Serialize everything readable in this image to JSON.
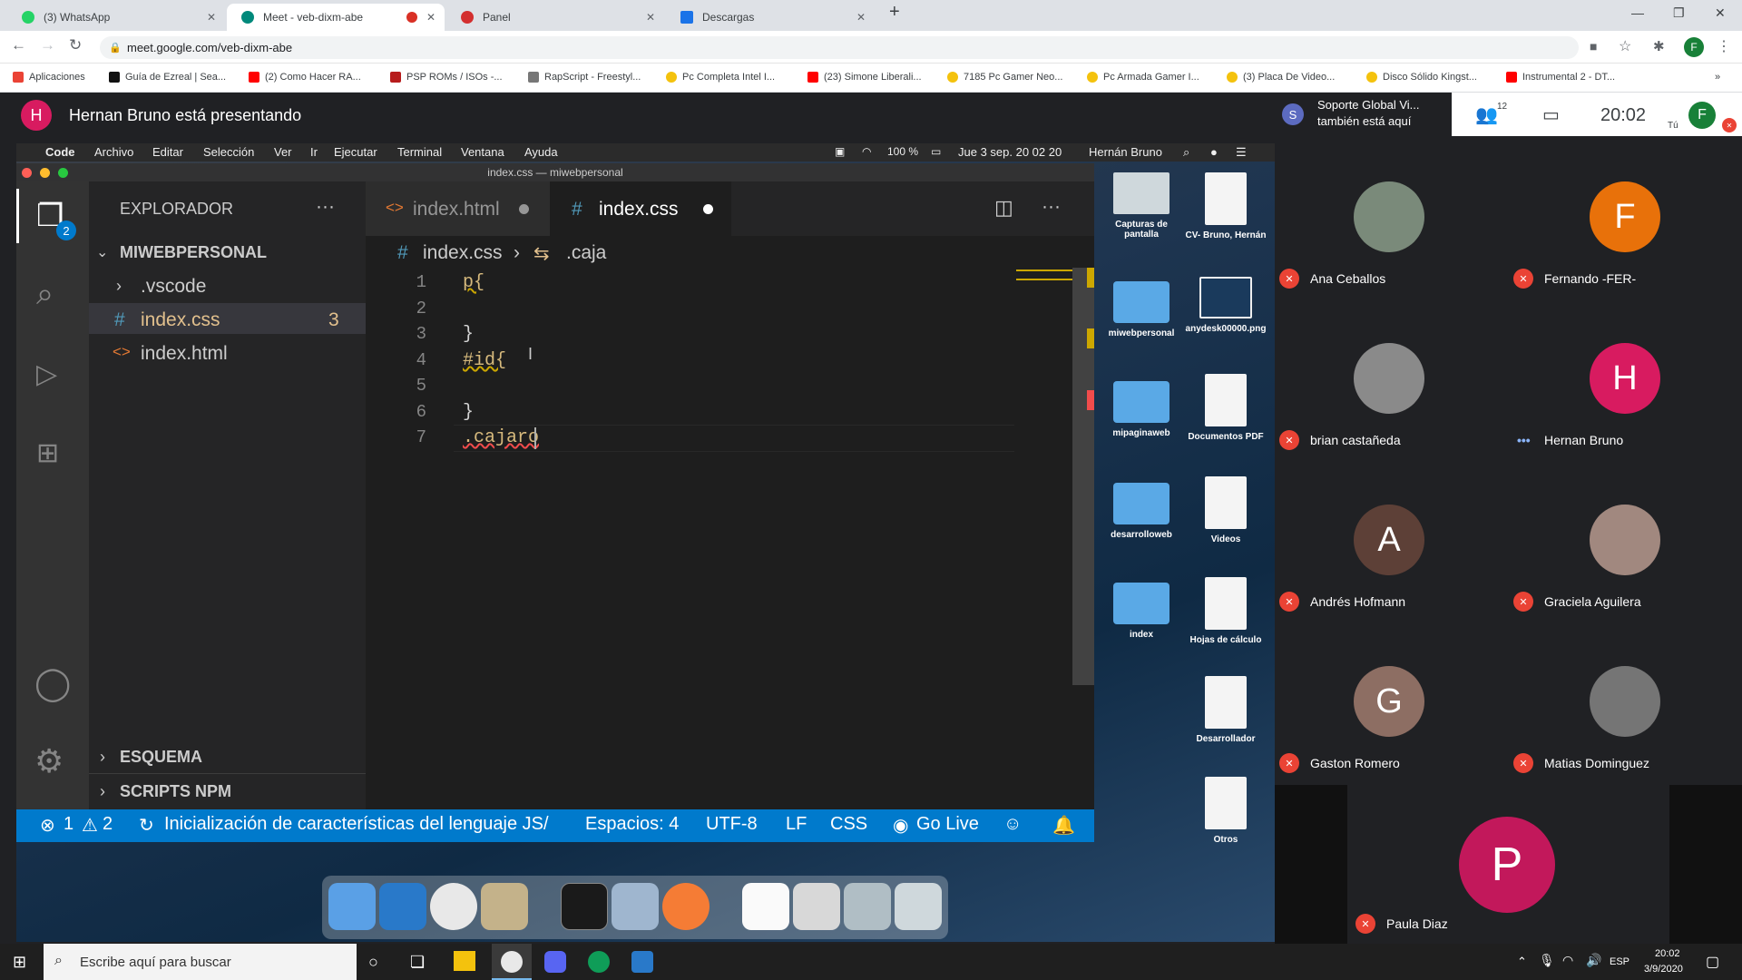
{
  "browser": {
    "tabs": [
      {
        "title": "(3) WhatsApp",
        "color": "#25d366"
      },
      {
        "title": "Meet - veb-dixm-abe",
        "color": "#00897b"
      },
      {
        "title": "Panel",
        "color": "#d32f2f"
      },
      {
        "title": "Descargas",
        "color": "#1a73e8"
      }
    ],
    "url": "meet.google.com/veb-dixm-abe",
    "bookmarks": [
      {
        "label": "Aplicaciones",
        "color": "#ea4335"
      },
      {
        "label": "Guía de Ezreal | Sea...",
        "color": "#111111"
      },
      {
        "label": "(2) Como Hacer RA...",
        "color": "#ff0000"
      },
      {
        "label": "PSP ROMs / ISOs -...",
        "color": "#b71c1c"
      },
      {
        "label": "RapScript - Freestyl...",
        "color": "#777777"
      },
      {
        "label": "Pc Completa Intel I...",
        "color": "#f4c20d"
      },
      {
        "label": "(23) Simone Liberali...",
        "color": "#ff0000"
      },
      {
        "label": "7185 Pc Gamer Neo...",
        "color": "#f4c20d"
      },
      {
        "label": "Pc Armada Gamer I...",
        "color": "#f4c20d"
      },
      {
        "label": "(3) Placa De Video...",
        "color": "#f4c20d"
      },
      {
        "label": "Disco Sólido Kingst...",
        "color": "#f4c20d"
      },
      {
        "label": "Instrumental 2 - DT...",
        "color": "#ff0000"
      }
    ]
  },
  "meet": {
    "presenter_initial": "H",
    "presenter_text": "Hernan Bruno está presentando",
    "support_initial": "S",
    "support_text_1": "Soporte Global Vi...",
    "support_text_2": "también está aquí",
    "people_count": "12",
    "time": "20:02",
    "self_initial": "F",
    "self_label": "Tú",
    "participants": [
      {
        "name": "Ana Ceballos",
        "initial": "",
        "color": "#7a8a7a",
        "muted": true
      },
      {
        "name": "Fernando -FER-",
        "initial": "F",
        "color": "#e8710a",
        "muted": true
      },
      {
        "name": "brian castañeda",
        "initial": "",
        "color": "#8a8a8a",
        "muted": true
      },
      {
        "name": "Hernan Bruno",
        "initial": "H",
        "color": "#d81b60",
        "muted": false
      },
      {
        "name": "Andrés Hofmann",
        "initial": "A",
        "color": "#5d4037",
        "muted": true
      },
      {
        "name": "Graciela Aguilera",
        "initial": "",
        "color": "#a1887f",
        "muted": true
      },
      {
        "name": "Gaston Romero",
        "initial": "G",
        "color": "#8d6e63",
        "muted": true
      },
      {
        "name": "Matias Dominguez",
        "initial": "",
        "color": "#757575",
        "muted": true
      },
      {
        "name": "Paula Diaz",
        "initial": "P",
        "color": "#c2185b",
        "muted": true
      }
    ]
  },
  "mac": {
    "menu": [
      "Code",
      "Archivo",
      "Editar",
      "Selección",
      "Ver",
      "Ir",
      "Ejecutar",
      "Terminal",
      "Ventana",
      "Ayuda"
    ],
    "battery": "100 %",
    "clock": "Jue 3 sep. 20 02 20",
    "user": "Hernán Bruno",
    "desktop": [
      {
        "label": "Capturas de pantalla",
        "kind": "doc"
      },
      {
        "label": "CV- Bruno, Hernán",
        "kind": "doc"
      },
      {
        "label": "miwebpersonal",
        "kind": "folder"
      },
      {
        "label": "anydesk00000.png",
        "kind": "doc"
      },
      {
        "label": "mipaginaweb",
        "kind": "folder"
      },
      {
        "label": "Documentos PDF",
        "kind": "doc"
      },
      {
        "label": "desarrolloweb",
        "kind": "folder"
      },
      {
        "label": "Videos",
        "kind": "doc"
      },
      {
        "label": "index",
        "kind": "folder"
      },
      {
        "label": "Hojas de cálculo",
        "kind": "doc"
      },
      {
        "label": "Desarrollador",
        "kind": "doc"
      },
      {
        "label": "Otros",
        "kind": "doc"
      }
    ]
  },
  "vscode": {
    "window_title": "index.css — miwebpersonal",
    "explorer_title": "EXPLORADOR",
    "explorer_badge": "2",
    "project": "MIWEBPERSONAL",
    "files": [
      {
        "name": ".vscode",
        "icon": ">",
        "badge": ""
      },
      {
        "name": "index.css",
        "icon": "#",
        "badge": "3"
      },
      {
        "name": "index.html",
        "icon": "<>",
        "badge": ""
      }
    ],
    "outline": "ESQUEMA",
    "npm": "SCRIPTS NPM",
    "tabs": [
      {
        "name": "index.html",
        "icon": "<>"
      },
      {
        "name": "index.css",
        "icon": "#"
      }
    ],
    "breadcrumb_file": "index.css",
    "breadcrumb_symbol": ".caja",
    "lines": [
      "p{",
      "",
      "}",
      "#id{",
      "",
      "}",
      ".cajaro"
    ],
    "status": {
      "errors": "1",
      "warnings": "2",
      "message": "Inicialización de características del lenguaje JS/",
      "spaces": "Espacios: 4",
      "encoding": "UTF-8",
      "eol": "LF",
      "language": "CSS",
      "golive": "Go Live"
    }
  },
  "taskbar": {
    "search_placeholder": "Escribe aquí para buscar",
    "lang": "ESP",
    "time": "20:02",
    "date": "3/9/2020"
  }
}
